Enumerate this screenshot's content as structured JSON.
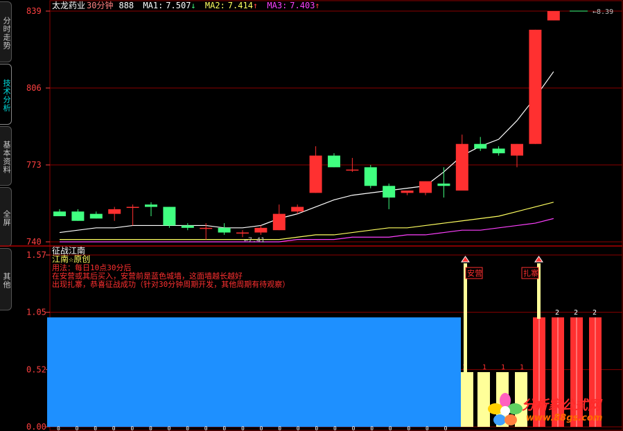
{
  "sidebar": {
    "tabs": [
      {
        "label": "分时走势",
        "active": false
      },
      {
        "label": "技术分析",
        "active": true
      },
      {
        "label": "基本资料",
        "active": false
      },
      {
        "label": "全屏",
        "active": false
      },
      {
        "label": "其他",
        "active": false
      }
    ]
  },
  "header": {
    "stock_name": "太龙药业",
    "period": "30分钟",
    "code": "888",
    "ma1_label": "MA1:",
    "ma1_value": "7.507",
    "ma1_arrow": "↓",
    "ma2_label": "MA2:",
    "ma2_value": "7.414",
    "ma2_arrow": "↑",
    "ma3_label": "MA3:",
    "ma3_value": "7.403",
    "ma3_arrow": "↑"
  },
  "colors": {
    "up": "#ff3030",
    "down": "#40ff80",
    "ma1": "#ffffff",
    "ma2": "#ffff60",
    "ma3": "#ff40ff",
    "grid": "#8b0000",
    "axis_text": "#ff4040",
    "blue_bar": "#1e90ff",
    "pale_bar": "#ffff99"
  },
  "indicator": {
    "title": "征战江南",
    "subtitle": "江南☆原创",
    "usage_lines": [
      "用法：每日10点30分后",
      "在安营或其后买入，安营前是蓝色城墙，这面墙越长越好",
      "出现扎寨，恭喜征战成功（针对30分钟周期开发，其他周期有待观察）"
    ],
    "label_anying": "安营",
    "label_zhazhai": "扎寨",
    "bar_glyph_1": "1",
    "bar_glyph_2": "2"
  },
  "watermark": {
    "line1": "分析家公式网",
    "line2": "www.88gs.com"
  },
  "chart_data": [
    {
      "type": "candlestick",
      "title": "太龙药业 30分钟",
      "ylim": [
        7.4,
        8.39
      ],
      "y_ticks": [
        "839",
        "806",
        "773",
        "740"
      ],
      "annotations": [
        "←8.39",
        "←7.41"
      ],
      "candles": [
        {
          "o": 7.53,
          "h": 7.54,
          "l": 7.51,
          "c": 7.51
        },
        {
          "o": 7.53,
          "h": 7.54,
          "l": 7.49,
          "c": 7.49
        },
        {
          "o": 7.52,
          "h": 7.53,
          "l": 7.5,
          "c": 7.5
        },
        {
          "o": 7.52,
          "h": 7.55,
          "l": 7.49,
          "c": 7.54
        },
        {
          "o": 7.55,
          "h": 7.56,
          "l": 7.47,
          "c": 7.55
        },
        {
          "o": 7.56,
          "h": 7.57,
          "l": 7.51,
          "c": 7.55
        },
        {
          "o": 7.55,
          "h": 7.55,
          "l": 7.46,
          "c": 7.47
        },
        {
          "o": 7.47,
          "h": 7.48,
          "l": 7.45,
          "c": 7.46
        },
        {
          "o": 7.46,
          "h": 7.48,
          "l": 7.41,
          "c": 7.46
        },
        {
          "o": 7.46,
          "h": 7.48,
          "l": 7.43,
          "c": 7.44
        },
        {
          "o": 7.44,
          "h": 7.45,
          "l": 7.42,
          "c": 7.44
        },
        {
          "o": 7.44,
          "h": 7.47,
          "l": 7.43,
          "c": 7.46
        },
        {
          "o": 7.45,
          "h": 7.56,
          "l": 7.45,
          "c": 7.52
        },
        {
          "o": 7.53,
          "h": 7.56,
          "l": 7.52,
          "c": 7.55
        },
        {
          "o": 7.61,
          "h": 7.81,
          "l": 7.61,
          "c": 7.77
        },
        {
          "o": 7.77,
          "h": 7.78,
          "l": 7.72,
          "c": 7.72
        },
        {
          "o": 7.71,
          "h": 7.76,
          "l": 7.7,
          "c": 7.71
        },
        {
          "o": 7.72,
          "h": 7.73,
          "l": 7.63,
          "c": 7.64
        },
        {
          "o": 7.64,
          "h": 7.65,
          "l": 7.54,
          "c": 7.59
        },
        {
          "o": 7.61,
          "h": 7.62,
          "l": 7.6,
          "c": 7.62
        },
        {
          "o": 7.61,
          "h": 7.66,
          "l": 7.6,
          "c": 7.66
        },
        {
          "o": 7.65,
          "h": 7.72,
          "l": 7.59,
          "c": 7.64
        },
        {
          "o": 7.62,
          "h": 7.86,
          "l": 7.62,
          "c": 7.82
        },
        {
          "o": 7.82,
          "h": 7.85,
          "l": 7.79,
          "c": 7.8
        },
        {
          "o": 7.8,
          "h": 7.81,
          "l": 7.77,
          "c": 7.78
        },
        {
          "o": 7.77,
          "h": 7.82,
          "l": 7.72,
          "c": 7.82
        },
        {
          "o": 7.82,
          "h": 8.31,
          "l": 7.82,
          "c": 8.31
        },
        {
          "o": 8.35,
          "h": 8.39,
          "l": 8.35,
          "c": 8.39
        }
      ],
      "ma1": [
        7.44,
        7.45,
        7.46,
        7.46,
        7.47,
        7.47,
        7.47,
        7.47,
        7.47,
        7.46,
        7.46,
        7.47,
        7.5,
        7.52,
        7.55,
        7.58,
        7.6,
        7.61,
        7.62,
        7.63,
        7.64,
        7.7,
        7.77,
        7.81,
        7.84,
        7.92,
        8.02,
        8.13
      ],
      "ma2": [
        7.41,
        7.41,
        7.41,
        7.41,
        7.41,
        7.41,
        7.41,
        7.41,
        7.41,
        7.41,
        7.41,
        7.41,
        7.41,
        7.42,
        7.43,
        7.43,
        7.44,
        7.45,
        7.46,
        7.46,
        7.47,
        7.48,
        7.49,
        7.5,
        7.51,
        7.53,
        7.55,
        7.57
      ],
      "ma3": [
        7.4,
        7.4,
        7.4,
        7.4,
        7.4,
        7.4,
        7.4,
        7.4,
        7.4,
        7.4,
        7.4,
        7.4,
        7.4,
        7.41,
        7.41,
        7.41,
        7.42,
        7.42,
        7.42,
        7.43,
        7.43,
        7.44,
        7.45,
        7.45,
        7.46,
        7.47,
        7.48,
        7.5
      ]
    },
    {
      "type": "bar",
      "title": "征战江南",
      "ylim": [
        0,
        1.57
      ],
      "y_ticks": [
        "1.57",
        "1.05",
        "0.52",
        "0.00"
      ],
      "blue_wall_value": 1.0,
      "blue_wall_count": 22,
      "pale_bars": [
        0.5,
        0.5,
        0.5,
        0.5
      ],
      "red_bars": [
        1.0,
        1.0,
        1.0,
        1.0
      ]
    }
  ]
}
